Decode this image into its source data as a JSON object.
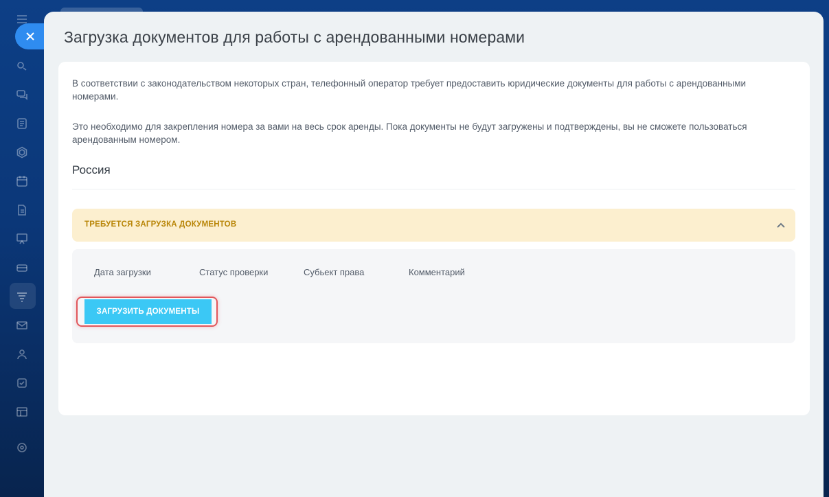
{
  "slider": {
    "title": "Загрузка документов для работы с арендованными номерами"
  },
  "intro": {
    "paragraph_1": "В соответствии с законодательством некоторых стран, телефонный оператор требует предоставить юридические документы для работы с арендованными номерами.",
    "paragraph_2": "Это необходимо для закрепления номера за вами на весь срок аренды. Пока документы не будут загружены и подтверждены, вы не сможете пользоваться арендованным номером."
  },
  "country": {
    "name": "Россия",
    "status_label": "ТРЕБУЕТСЯ ЗАГРУЗКА ДОКУМЕНТОВ",
    "table": {
      "columns": [
        "Дата загрузки",
        "Статус проверки",
        "Субьект права",
        "Комментарий"
      ]
    },
    "upload_button_label": "ЗАГРУЗИТЬ ДОКУМЕНТЫ"
  },
  "colors": {
    "accent_button": "#3bc8f5",
    "warning_bg": "#fcefcf",
    "warning_text": "#b98608",
    "highlight_border": "#e1565b",
    "close_button": "#2f8cf0"
  },
  "icons": {
    "sidebar": [
      "menu-icon",
      "sync-icon",
      "chat-icon",
      "feed-icon",
      "hexagon-icon",
      "calendar-icon",
      "document-icon",
      "presentation-icon",
      "drive-icon",
      "crm-filter-icon",
      "mail-icon",
      "contacts-icon",
      "tasks-icon",
      "sites-icon",
      "settings-icon"
    ],
    "close": "close-icon",
    "collapse": "chevron-up-icon"
  }
}
